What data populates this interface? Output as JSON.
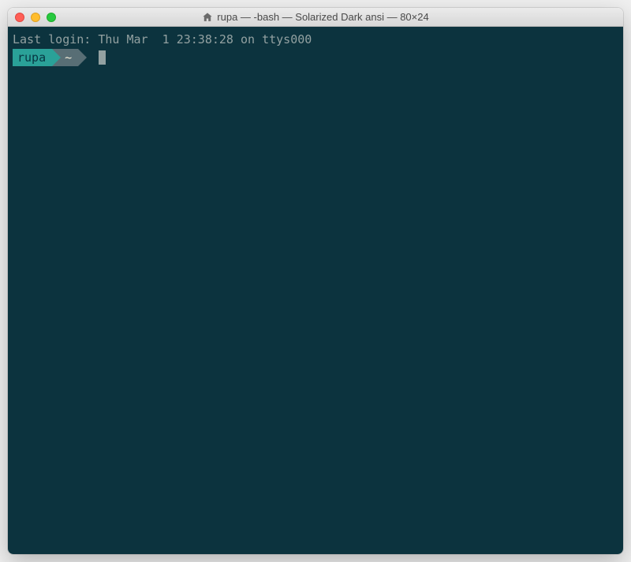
{
  "window": {
    "title": "rupa — -bash — Solarized Dark ansi — 80×24"
  },
  "terminal": {
    "last_login": "Last login: Thu Mar  1 23:38:28 on ttys000",
    "prompt": {
      "user": "rupa",
      "dir": "~"
    }
  }
}
